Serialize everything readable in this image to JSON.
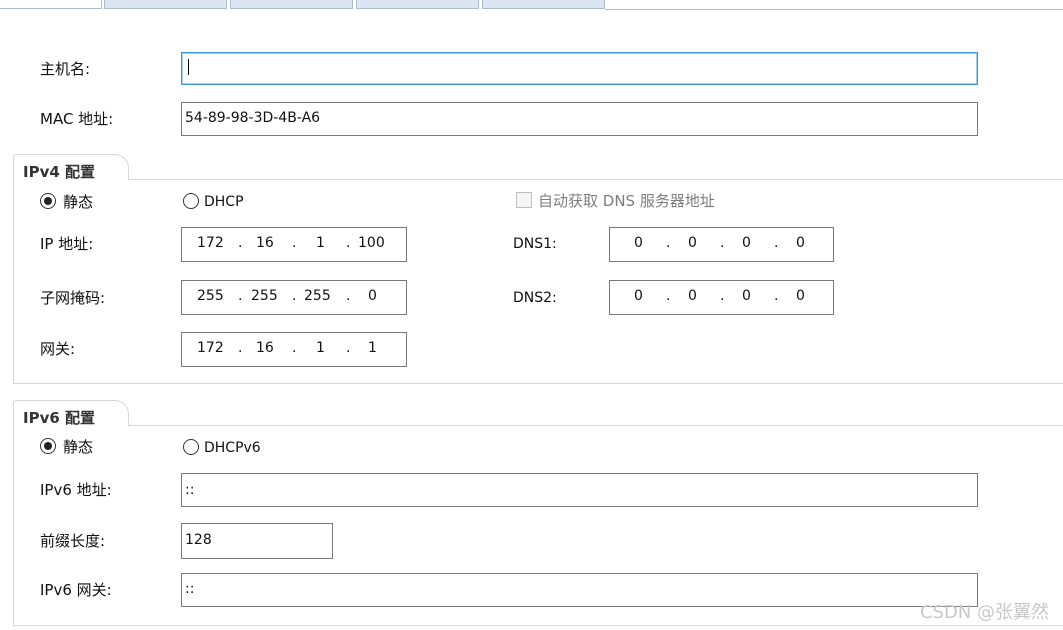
{
  "host": {
    "label": "主机名:",
    "value": ""
  },
  "mac": {
    "label": "MAC 地址:",
    "value": "54-89-98-3D-4B-A6"
  },
  "ipv4": {
    "title": "IPv4 配置",
    "static_label": "静态",
    "dhcp_label": "DHCP",
    "static_selected": true,
    "auto_dns_label": "自动获取 DNS 服务器地址",
    "auto_dns_checked": false,
    "ip": {
      "label": "IP 地址:",
      "octets": [
        "172",
        "16",
        "1",
        "100"
      ]
    },
    "mask": {
      "label": "子网掩码:",
      "octets": [
        "255",
        "255",
        "255",
        "0"
      ]
    },
    "gateway": {
      "label": "网关:",
      "octets": [
        "172",
        "16",
        "1",
        "1"
      ]
    },
    "dns1": {
      "label": "DNS1:",
      "octets": [
        "0",
        "0",
        "0",
        "0"
      ]
    },
    "dns2": {
      "label": "DNS2:",
      "octets": [
        "0",
        "0",
        "0",
        "0"
      ]
    }
  },
  "ipv6": {
    "title": "IPv6 配置",
    "static_label": "静态",
    "dhcp_label": "DHCPv6",
    "static_selected": true,
    "address": {
      "label": "IPv6 地址:",
      "value": "::"
    },
    "prefix": {
      "label": "前缀长度:",
      "value": "128"
    },
    "gateway": {
      "label": "IPv6 网关:",
      "value": "::"
    }
  },
  "dot": ".",
  "watermark": "CSDN @张翼然"
}
